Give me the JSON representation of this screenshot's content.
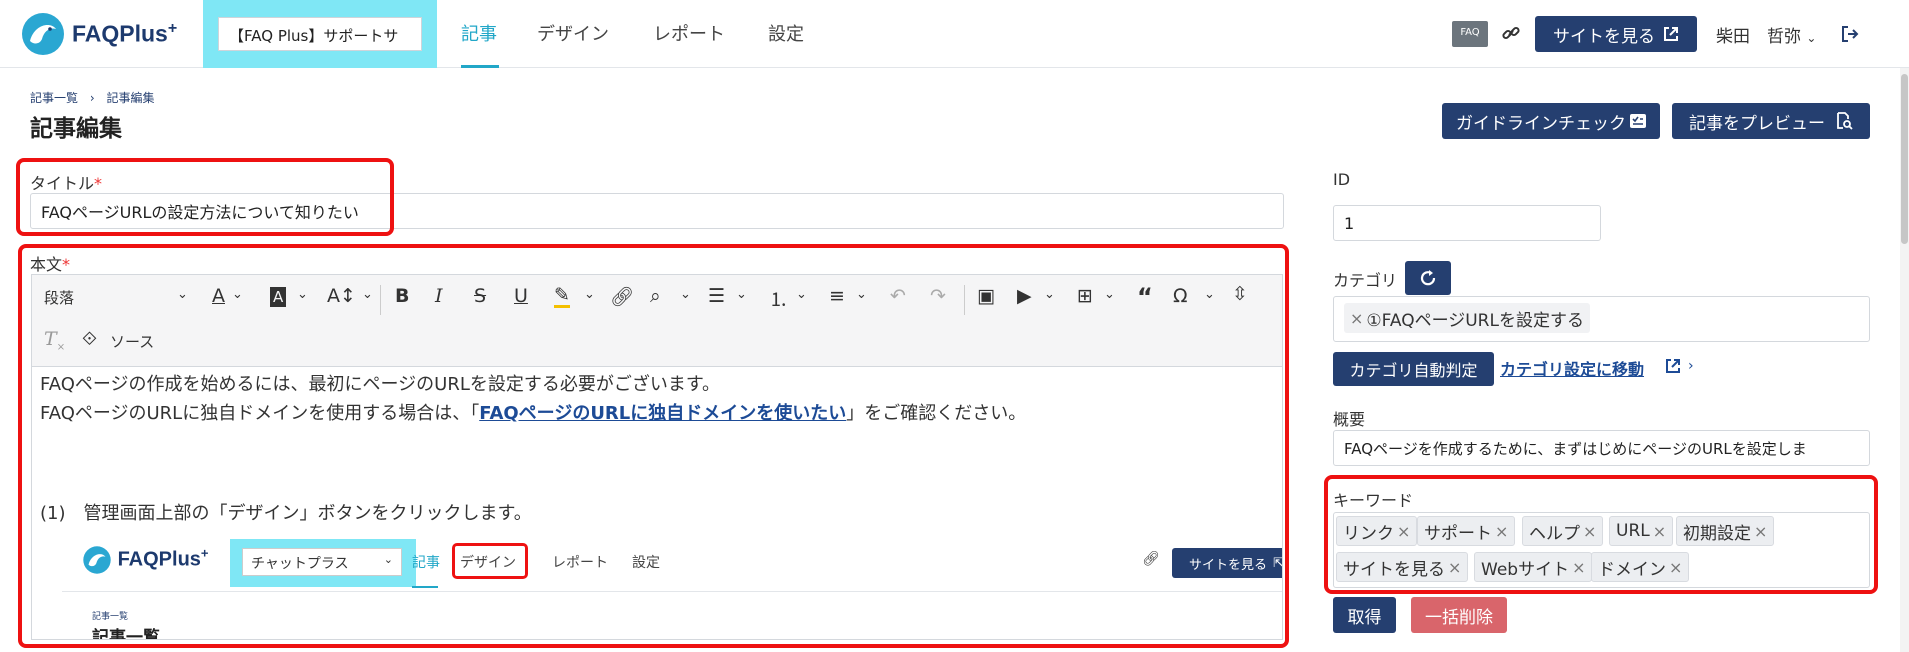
{
  "nav": {
    "logo_text": "FAQPlus",
    "logo_plus": "+",
    "site_select": "【FAQ Plus】サポートサ",
    "tabs": [
      "記事",
      "デザイン",
      "レポート",
      "設定"
    ],
    "faq_badge": "FAQ",
    "site_button": "サイトを見る",
    "user_name": "柴田　哲弥"
  },
  "header": {
    "breadcrumb_list": "記事一覧",
    "breadcrumb_sep": "›",
    "breadcrumb_current": "記事編集",
    "title": "記事編集",
    "guideline_button": "ガイドラインチェック",
    "preview_button": "記事をプレビュー"
  },
  "form": {
    "title_label": "タイトル",
    "required_mark": "*",
    "title_value": "FAQページURLの設定方法について知りたい",
    "body_label": "本文",
    "toolbar": {
      "paragraph_select": "段落",
      "source_label": "ソース"
    },
    "body": {
      "line1": "FAQページの作成を始めるには、最初にページのURLを設定する必要がございます。",
      "line2_pre": "FAQページのURLに独自ドメインを使用する場合は、「",
      "line2_link": "FAQページのURLに独自ドメインを使いたい",
      "line2_post": "」をご確認ください。",
      "step1": "(1)　管理画面上部の「デザイン」ボタンをクリックします。"
    },
    "embedded": {
      "logo_text": "FAQPlus",
      "logo_plus": "+",
      "select_value": "チャットプラス",
      "tabs": [
        "記事",
        "デザイン",
        "レポート",
        "設定"
      ],
      "site_button": "サイトを見る",
      "breadcrumb": "記事一覧",
      "title": "記事一覧"
    }
  },
  "sidebar": {
    "id_label": "ID",
    "id_value": "1",
    "category_label": "カテゴリ",
    "category_tag": "①FAQページURLを設定する",
    "auto_category_button": "カテゴリ自動判定",
    "category_settings_link": "カテゴリ設定に移動",
    "summary_label": "概要",
    "summary_value": "FAQページを作成するために、まずはじめにページのURLを設定しま",
    "keyword_label": "キーワード",
    "keywords": [
      "リンク",
      "サポート",
      "ヘルプ",
      "URL",
      "初期設定",
      "サイトを見る",
      "Webサイト",
      "ドメイン"
    ],
    "fetch_button": "取得",
    "delete_all_button": "一括削除"
  },
  "colors": {
    "navy": "#253f70",
    "cyan_highlight": "#7fe7f5",
    "active_tab": "#22a7c8",
    "annotation_red": "#e11111",
    "danger_button": "#d9656b"
  }
}
